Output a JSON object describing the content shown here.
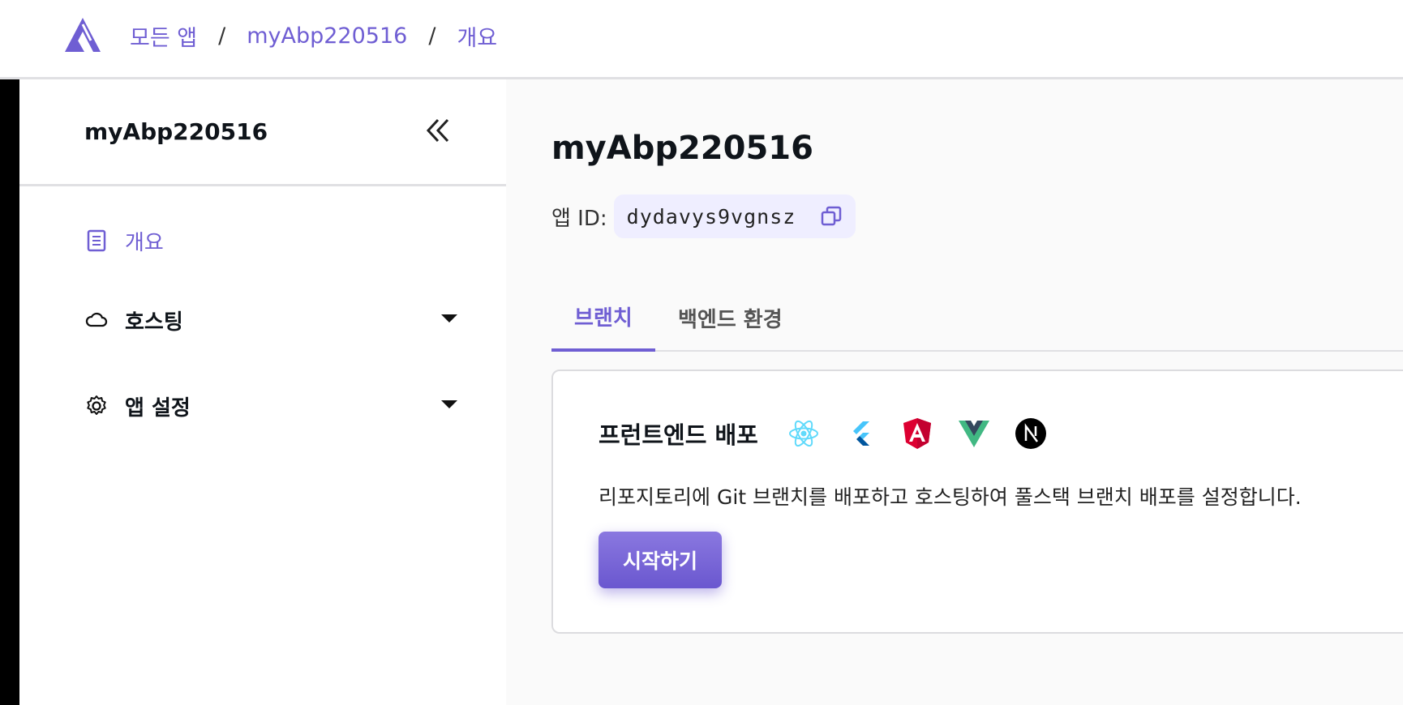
{
  "breadcrumb": {
    "all_apps": "모든 앱",
    "app": "myAbp220516",
    "current": "개요",
    "separator": "/"
  },
  "sidebar": {
    "title": "myAbp220516",
    "items": [
      {
        "label": "개요",
        "icon": "document-icon",
        "active": true
      },
      {
        "label": "호스팅",
        "icon": "cloud-icon",
        "expandable": true
      },
      {
        "label": "앱 설정",
        "icon": "gear-icon",
        "expandable": true
      }
    ]
  },
  "main": {
    "title": "myAbp220516",
    "app_id_label": "앱 ID:",
    "app_id": "dydavys9vgnsz",
    "tabs": [
      {
        "label": "브랜치",
        "active": true
      },
      {
        "label": "백엔드 환경",
        "active": false
      }
    ],
    "card": {
      "title": "프런트엔드 배포",
      "framework_icons": [
        "react-icon",
        "flutter-icon",
        "angular-icon",
        "vue-icon",
        "nextjs-icon"
      ],
      "description": "리포지토리에 Git 브랜치를 배포하고 호스팅하여 풀스택 브랜치 배포를 설정합니다.",
      "button": "시작하기"
    }
  },
  "colors": {
    "accent": "#6f5ed3",
    "border": "#e0e0e3"
  }
}
